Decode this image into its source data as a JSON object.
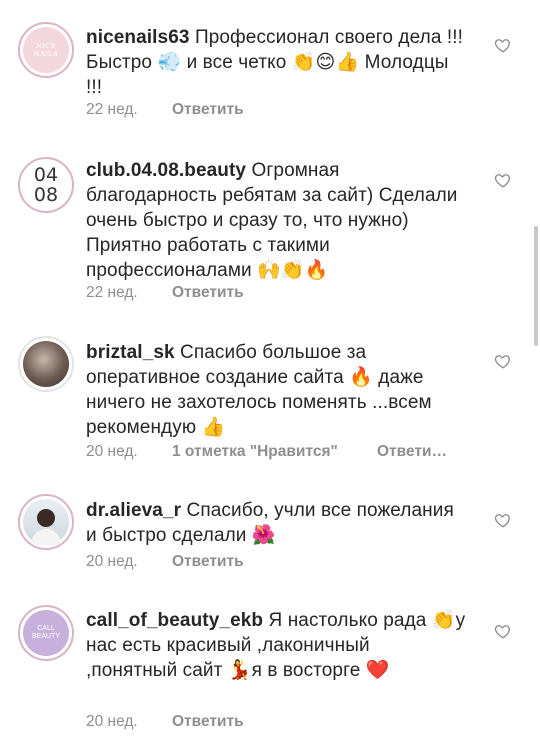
{
  "comments": [
    {
      "username": "nicenails63",
      "text": "Профессионал своего дела !!! Быстро 💨 и все четко 👏😊👍 Молодцы !!!",
      "time": "22 нед.",
      "reply_label": "Ответить",
      "avatar": "NICE NAILS"
    },
    {
      "username": "club.04.08.beauty",
      "text": "Огромная благодарность ребятам за сайт) Сделали очень быстро и сразу то, что нужно) Приятно работать с такими профессионалами 🙌👏🔥",
      "time": "22 нед.",
      "reply_label": "Ответить",
      "avatar_top": "04",
      "avatar_bottom": "08"
    },
    {
      "username": "briztal_sk",
      "text": "Спасибо большое за оперативное создание сайта 🔥 даже ничего не захотелось поменять ...всем рекомендую 👍",
      "time": "20 нед.",
      "likes": "1 отметка \"Нравится\"",
      "reply_label": "Ответи…"
    },
    {
      "username": "dr.alieva_r",
      "text": "Спасибо, учли все пожелания и быстро сделали 🌺",
      "time": "20 нед.",
      "reply_label": "Ответить"
    },
    {
      "username": "call_of_beauty_ekb",
      "text": "Я настолько рада 👏у нас есть красивый ,лаконичный ,понятный сайт 💃я в восторге ❤️",
      "time": "20 нед.",
      "reply_label": "Ответить",
      "avatar": "CALL BEAUTY"
    }
  ],
  "colors": {
    "text": "#262626",
    "muted": "#8e8e8e",
    "avatar_ring": "#d9b3c6"
  },
  "icons": {
    "like": "heart-outline-icon"
  }
}
